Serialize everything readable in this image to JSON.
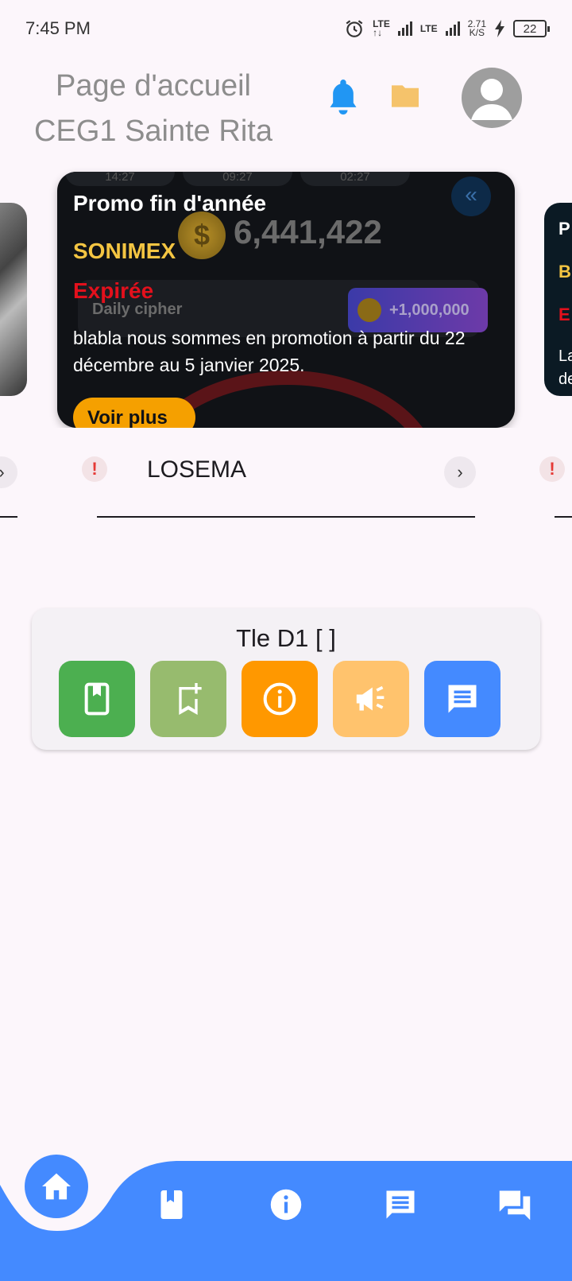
{
  "status_bar": {
    "time": "7:45 PM",
    "net1": "LTE",
    "net1_sub": "↑↓",
    "net2": "LTE",
    "speed_value": "2.71",
    "speed_unit": "K/S",
    "battery": "22"
  },
  "header": {
    "title_line1": "Page d'accueil",
    "title_line2": "CEG1 Sainte Rita",
    "icons": [
      "bell-icon",
      "folder-icon",
      "account-icon"
    ],
    "colors": {
      "bell": "#2196f3",
      "folder": "#f5c36b",
      "avatar": "#9e9e9e"
    }
  },
  "promo": {
    "title": "Promo fin d'année",
    "brand": "SONIMEX",
    "status": "Expirée",
    "description": "blabla nous sommes en promotion à partir du 22 décembre au 5 janvier 2025.",
    "join_label": "Voir plus",
    "background": {
      "pill1": "14:27",
      "pill2": "09:27",
      "pill3": "02:27",
      "coin_symbol": "$",
      "balance": "6,441,422",
      "cipher_label": "Daily cipher",
      "cipher_reward": "+1,000,000"
    },
    "colors": {
      "card": "#101216",
      "brand": "#f4c542",
      "status": "#e3101c",
      "join": "#f5a000"
    }
  },
  "side_card_right": {
    "line1": "P",
    "line2": "B",
    "line3": "E",
    "line4": "La",
    "line5": "de"
  },
  "tabs": {
    "active_label": "LOSEMA"
  },
  "class_panel": {
    "title": "Tle D1 [  ]",
    "buttons": [
      {
        "icon": "book-icon",
        "color": "#4caf50"
      },
      {
        "icon": "bookmark-add-icon",
        "color": "#97bb6e"
      },
      {
        "icon": "info-icon",
        "color": "#ff9800"
      },
      {
        "icon": "campaign-icon",
        "color": "#ffc36d"
      },
      {
        "icon": "message-icon",
        "color": "#448aff"
      }
    ]
  },
  "bottom_nav": {
    "items": [
      "home-icon",
      "book-icon",
      "info-icon",
      "message-icon",
      "forum-icon"
    ],
    "color": "#448aff"
  }
}
